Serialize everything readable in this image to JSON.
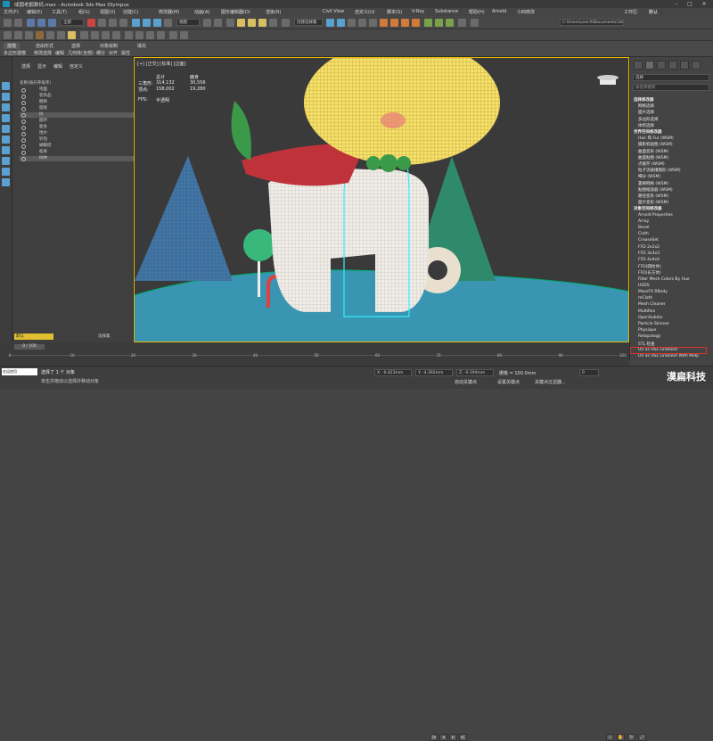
{
  "app": {
    "title": "成圆老鹤数码.max - Autodesk 3ds Max Olympus",
    "workspace": "工作区:",
    "workspace_value": "默认"
  },
  "menu": [
    "文件(F)",
    "编辑(E)",
    "工具(T)",
    "组(G)",
    "视图(V)",
    "创建(C)",
    "修改器(M)",
    "动画(A)",
    "图形编辑器(D)",
    "渲染(R)",
    "Civil View",
    "自定义(U)",
    "脚本(S)",
    "V-Ray",
    "Substance",
    "Arnold",
    "帮助(H)",
    "小四修改"
  ],
  "toolbar": {
    "selection_filter": "全部",
    "view": "视图",
    "named_set": "创建选择集",
    "search_field": "Objects Are Selected to",
    "path": "C:\\Users\\userX\\Documents\\3ds Max 2024"
  },
  "ribbon": {
    "tabs": [
      "建模",
      "自由形式",
      "选择",
      "对象绘制",
      "填充"
    ],
    "label": "多边形建模",
    "sub": [
      "修改选择",
      "编辑",
      "几何体(全部)",
      "细分",
      "对齐",
      "属性"
    ]
  },
  "scene_explorer": {
    "tabs": [
      "选择",
      "显示",
      "编辑",
      "自定义"
    ],
    "column": "名称(按升序排序)",
    "rows": [
      "地面",
      "装饰品",
      "糖果",
      "圆盘",
      "树",
      "圆环",
      "鹿身",
      "围巾",
      "铃铛",
      "蝴蝶结",
      "松果",
      "树林"
    ],
    "selected_index": [
      4,
      11
    ]
  },
  "viewport": {
    "label": "[+] [正交] [标准] [边面]",
    "stats": {
      "total_label": "总计",
      "selected_label": "鹿身",
      "polys_label": "三角形:",
      "verts_label": "顶点:",
      "polys_total": "314,132",
      "polys_sel": "30,556",
      "verts_total": "158,002",
      "verts_sel": "19,280",
      "fps_label": "FPS:",
      "fps_value": "半透明"
    }
  },
  "command_panel": {
    "dropdown": "选择",
    "search": "按名称搜索",
    "header1": "选择修改器",
    "items1": [
      "网格选择",
      "面片选择",
      "多边形选择",
      "体积选择"
    ],
    "header2": "世界空间修改器",
    "items2": [
      "Hair 和 Fur (WSM)",
      "摄影机贴图 (WSM)",
      "曲面变形 (WSM)",
      "曲面贴图 (WSM)",
      "点缓存 (WSM)",
      "粒子流碰撞图形 (WSM)",
      "细分 (WSM)",
      "置换网格 (WSM)",
      "贴图缩放器 (WSM)",
      "路径变形 (WSM)",
      "面片变形 (WSM)"
    ],
    "header3": "对象空间修改器",
    "items3": [
      "Arnold Properties",
      "Array",
      "Bevel",
      "Cloth",
      "CreaseSet",
      "FFD 2x2x2",
      "FFD 3x3x3",
      "FFD 4x4x4",
      "FFD(圆柱体)",
      "FFD(长方体)",
      "Filter Mesh Colors By Hue",
      "HSDS",
      "MassFX RBody",
      "mCloth",
      "Mesh Cleaner",
      "MultiRes",
      "OpenSubdiv",
      "Particle Skinner",
      "Physique",
      "Retopology",
      "STL 检查",
      "UV as HSL Gradient",
      "UV as HSL Gradient With Midp"
    ],
    "highlighted": "Retopology"
  },
  "timeline": {
    "frame": "0 / 100",
    "ticks": [
      "0",
      "10",
      "20",
      "30",
      "40",
      "50",
      "60",
      "70",
      "80",
      "90",
      "100"
    ],
    "layer": "默认",
    "layer2": "选择集"
  },
  "status": {
    "selected": "选择了 1 个 对象",
    "hint": "单击并拖动以选择并移动对象",
    "script": "欢迎使用MAXScript。",
    "x": "X: -0.423mm",
    "y": "Y: -4.392mm",
    "z": "Z: -0.194mm",
    "grid": "栅格 = 100.0mm",
    "autokey": "自动关键点",
    "setkey": "设置关键点",
    "keyfilter": "关键点过滤器...",
    "frame": "0"
  },
  "watermark": "漠扁科技"
}
